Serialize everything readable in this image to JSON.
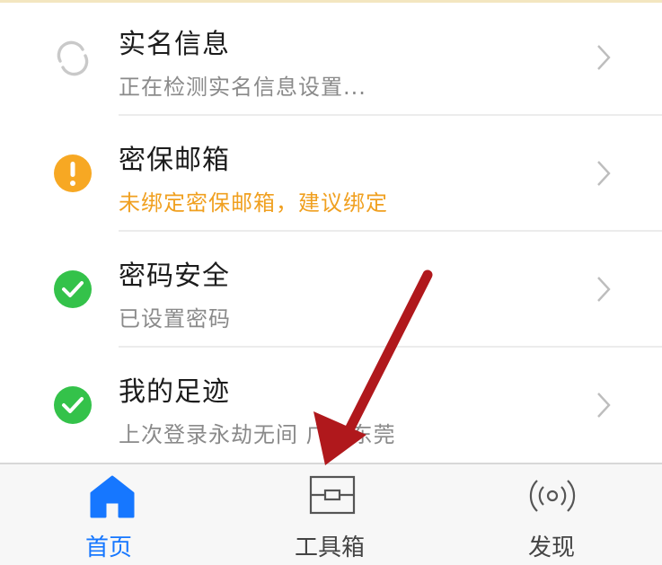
{
  "security_items": [
    {
      "title": "实名信息",
      "subtitle": "正在检测实名信息设置...",
      "status": "loading",
      "icon": "loading-spinner-icon"
    },
    {
      "title": "密保邮箱",
      "subtitle": "未绑定密保邮箱，建议绑定",
      "status": "warning",
      "icon": "warning-icon"
    },
    {
      "title": "密码安全",
      "subtitle": "已设置密码",
      "status": "ok",
      "icon": "check-circle-icon"
    },
    {
      "title": "我的足迹",
      "subtitle": "上次登录永劫无间 广东东莞",
      "status": "ok",
      "icon": "check-circle-icon"
    }
  ],
  "tabbar": {
    "home_label": "首页",
    "toolbox_label": "工具箱",
    "discover_label": "发现"
  },
  "colors": {
    "accent_blue": "#1677ff",
    "warning_orange": "#f7a823",
    "ok_green": "#34c24a",
    "annotation_red": "#b0181c"
  }
}
